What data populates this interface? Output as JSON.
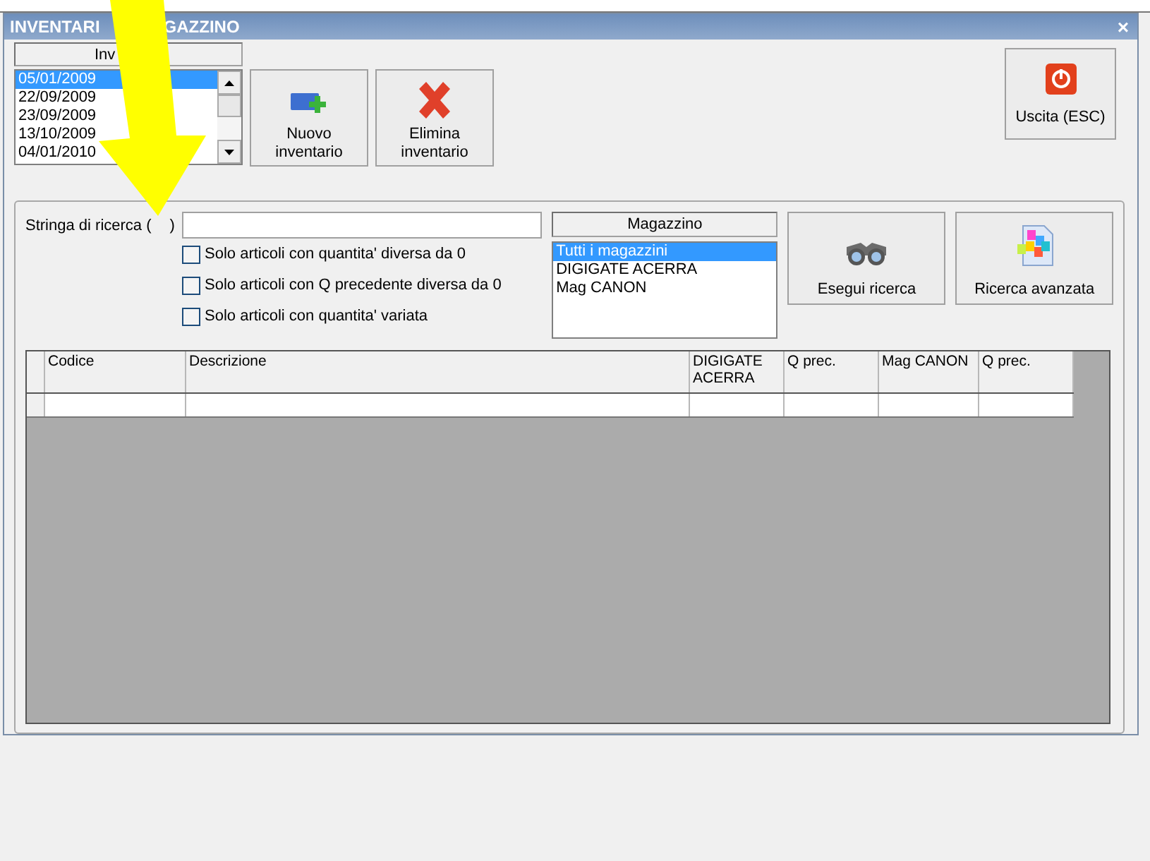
{
  "window": {
    "title_parts": [
      "INVENTARI",
      "GAZZINO"
    ],
    "close": "×"
  },
  "inventari": {
    "header": "Inv",
    "items": [
      {
        "label": "05/01/2009",
        "selected": true
      },
      {
        "label": "22/09/2009",
        "selected": false
      },
      {
        "label": "23/09/2009",
        "selected": false
      },
      {
        "label": "13/10/2009",
        "selected": false
      },
      {
        "label": "04/01/2010",
        "selected": false
      }
    ]
  },
  "buttons": [
    {
      "kind": "new",
      "label": "Nuovo inventario"
    },
    {
      "kind": "delete",
      "label": "Elimina inventario"
    }
  ],
  "exit_button": {
    "label": "Uscita (ESC)"
  },
  "search": {
    "label_parts": [
      "Stringa di ricerca (",
      ")"
    ]
  },
  "filters": [
    {
      "label": "Solo articoli con quantita' diversa da 0",
      "checked": false
    },
    {
      "label": "Solo articoli con Q precedente diversa da 0",
      "checked": false
    },
    {
      "label": "Solo articoli con quantita' variata",
      "checked": false
    }
  ],
  "magazzino": {
    "header": "Magazzino",
    "items": [
      {
        "label": "Tutti i magazzini",
        "selected": true
      },
      {
        "label": "DIGIGATE ACERRA",
        "selected": false
      },
      {
        "label": "Mag CANON",
        "selected": false
      }
    ]
  },
  "search_buttons": [
    {
      "kind": "search",
      "label": "Esegui ricerca"
    },
    {
      "kind": "advanced",
      "label": "Ricerca avanzata"
    }
  ],
  "table": {
    "columns": [
      "Codice",
      "Descrizione",
      "DIGIGATE ACERRA",
      "Q prec.",
      "Mag CANON",
      "Q prec."
    ]
  }
}
